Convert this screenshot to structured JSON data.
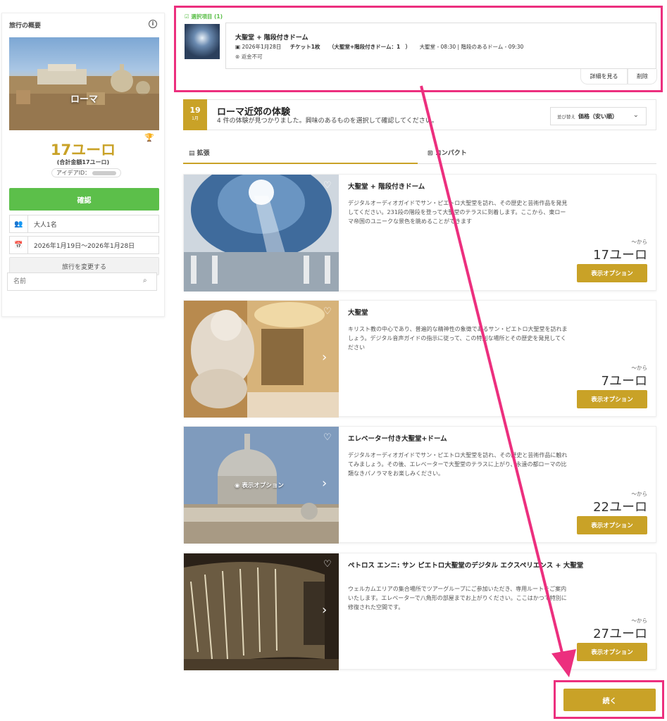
{
  "summary": {
    "title": "旅行の概要",
    "info_icon": "info-icon",
    "city": "ローマ",
    "price": "17ユーロ",
    "total": "(合計金額17ユーロ)",
    "idea_label": "アイデアID：",
    "confirm_label": "確認",
    "travelers": "大人1名",
    "dates": "2026年1月19日〜2026年1月28日",
    "change_label": "旅行を変更する",
    "name_placeholder": "名前"
  },
  "selected": {
    "header": "選択項目 (1)",
    "title": "大聖堂 + 階段付きドーム",
    "date": "2026年1月28日",
    "tickets": "チケット1枚",
    "ticket_detail": "（大聖堂+階段付きドーム：1　）",
    "times": "大聖堂 - 08:30 | 階段のあるドーム - 09:30",
    "refund": "返金不可",
    "detail_label": "詳細を見る",
    "delete_label": "削除"
  },
  "header": {
    "day": "19",
    "month": "1月",
    "title": "ローマ近郊の体験",
    "subtitle": "4 件の体験が見つかりました。興味のあるものを選択して確認してください。",
    "sort_label": "並び替え",
    "sort_value": "価格（安い順）"
  },
  "tabs": [
    {
      "label": "拡張"
    },
    {
      "label": "コンパクト"
    }
  ],
  "cards": [
    {
      "title": "大聖堂 + 階段付きドーム",
      "desc": "デジタルオーディオガイドでサン・ピエトロ大聖堂を訪れ、その歴史と芸術作品を発見してください。231段の階段を登って大聖堂のテラスに到着します。ここから、東ローマ帝国のユニークな景色を眺めることができます",
      "from": "〜から",
      "price": "17ユーロ",
      "option": "表示オプション"
    },
    {
      "title": "大聖堂",
      "desc": "キリスト教の中心であり、普遍的な精神性の象徴であるサン・ピエトロ大聖堂を訪れましょう。デジタル音声ガイドの指示に従って、この特別な場所とその歴史を発見してください",
      "from": "〜から",
      "price": "7ユーロ",
      "option": "表示オプション"
    },
    {
      "title": "エレベーター付き大聖堂+ドーム",
      "desc": "デジタルオーディオガイドでサン・ピエトロ大聖堂を訪れ、その歴史と芸術作品に触れてみましょう。その後、エレベーターで大聖堂のテラスに上がり、永遠の都ローマの比類なきパノラマをお楽しみください。",
      "from": "〜から",
      "price": "22ユーロ",
      "option": "表示オプション",
      "overlay": "表示オプション"
    },
    {
      "title": "ペトロス エンニ: サン ピエトロ大聖堂のデジタル エクスペリエンス + 大聖堂",
      "desc": "ウェルカムエリアの集合場所でツアーグループにご参加いただき、専用ルートをご案内いたします。エレベーターで八角形の部屋までお上がりください。ここはかつて特別に修復された空間です。",
      "from": "〜から",
      "price": "27ユーロ",
      "option": "表示オプション"
    }
  ],
  "continue_label": "続く",
  "colors": {
    "accent": "#c9a227",
    "confirm": "#5cbf4a",
    "highlight": "#ec2f7e"
  }
}
